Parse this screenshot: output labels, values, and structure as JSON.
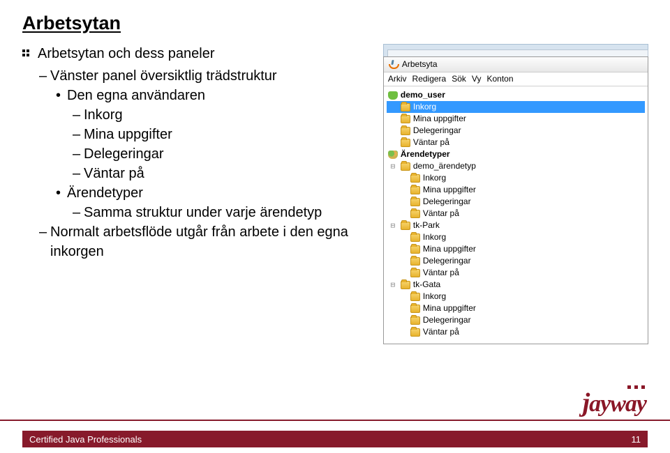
{
  "title": "Arbetsytan",
  "bullets": {
    "main": "Arbetsytan och dess paneler",
    "sub1": "Vänster panel översiktlig trädstruktur",
    "dot1": "Den egna användaren",
    "d1a": "Inkorg",
    "d1b": "Mina uppgifter",
    "d1c": "Delegeringar",
    "d1d": "Väntar på",
    "dot2": "Ärendetyper",
    "d2a": "Samma struktur under varje ärendetyp",
    "sub2": "Normalt arbetsflöde utgår från arbete i den egna inkorgen"
  },
  "shot": {
    "win_title": "Arbetsyta",
    "menu": [
      "Arkiv",
      "Redigera",
      "Sök",
      "Vy",
      "Konton"
    ],
    "user": "demo_user",
    "user_items": [
      "Inkorg",
      "Mina uppgifter",
      "Delegeringar",
      "Väntar på"
    ],
    "arendetyper": "Ärendetyper",
    "types": [
      {
        "name": "demo_ärendetyp",
        "items": [
          "Inkorg",
          "Mina uppgifter",
          "Delegeringar",
          "Väntar på"
        ]
      },
      {
        "name": "tk-Park",
        "items": [
          "Inkorg",
          "Mina uppgifter",
          "Delegeringar",
          "Väntar på"
        ]
      },
      {
        "name": "tk-Gata",
        "items": [
          "Inkorg",
          "Mina uppgifter",
          "Delegeringar",
          "Väntar på"
        ]
      }
    ]
  },
  "footer": {
    "text": "Certified Java Professionals",
    "page": "11",
    "logo": "jayway"
  }
}
